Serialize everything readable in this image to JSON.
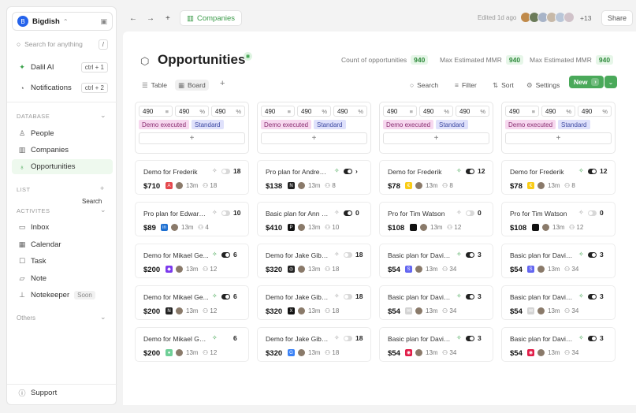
{
  "workspace": {
    "name": "Bigdish",
    "logo": "B"
  },
  "search": {
    "placeholder": "Search for anything",
    "shortcut": "/"
  },
  "top_nav": [
    {
      "label": "Dalil AI",
      "shortcut": "ctrl + 1",
      "icon": "sparkle-icon"
    },
    {
      "label": "Notifications",
      "shortcut": "ctrl + 2",
      "icon": "bell-icon"
    }
  ],
  "sections": {
    "database": "DATABASE",
    "list": "LIST",
    "list_search": "Search",
    "activities": "ACTIVITES",
    "others": "Others"
  },
  "database_items": [
    {
      "label": "People",
      "icon": "person-icon",
      "active": false
    },
    {
      "label": "Companies",
      "icon": "building-icon",
      "active": false
    },
    {
      "label": "Opportunities",
      "icon": "lightbulb-icon",
      "active": true
    }
  ],
  "activity_items": [
    {
      "label": "Inbox",
      "icon": "inbox-icon"
    },
    {
      "label": "Calendar",
      "icon": "calendar-icon"
    },
    {
      "label": "Task",
      "icon": "checkbox-icon"
    },
    {
      "label": "Note",
      "icon": "note-icon"
    },
    {
      "label": "Notekeeper",
      "icon": "pin-icon",
      "badge": "Soon"
    }
  ],
  "support": "Support",
  "header": {
    "breadcrumb": "Companies",
    "edited": "Edited 1d ago",
    "extra_avatars": "+13",
    "share": "Share"
  },
  "page": {
    "title": "Opportunities",
    "stats": [
      {
        "label": "Count of opportunities",
        "value": "940"
      },
      {
        "label": "Max Estimated MMR",
        "value": "940"
      },
      {
        "label": "Max Estimated MMR",
        "value": "940"
      }
    ]
  },
  "toolbar": {
    "views": [
      {
        "label": "Table",
        "active": false
      },
      {
        "label": "Board",
        "active": true
      }
    ],
    "search": "Search",
    "filter": "Filter",
    "sort": "Sort",
    "settings": "Settings",
    "new": "New"
  },
  "colors": {
    "accent": "#4aa95a",
    "tag_pink": "#f7d8ef",
    "tag_lavender": "#dfe1fb"
  },
  "columns": [
    {
      "filters": [
        {
          "value": "490",
          "op": "≡"
        },
        {
          "value": "490",
          "op": "%"
        },
        {
          "value": "490",
          "op": "%"
        }
      ],
      "tags": [
        "Demo executed",
        "Standard"
      ],
      "cards": [
        {
          "name": "Demo for Frederik",
          "spark": "grey",
          "toggle": "off",
          "count": "18",
          "amount": "$710",
          "logo_color": "#e5484d",
          "logo_glyph": "A",
          "time": "13m",
          "people": "18"
        },
        {
          "name": "Pro plan for Edwarw...",
          "spark": "grey",
          "toggle": "off",
          "count": "10",
          "amount": "$89",
          "logo_color": "#1d6fd1",
          "logo_glyph": "in",
          "time": "13m",
          "people": "4"
        },
        {
          "name": "Demo for Mikael Ge...",
          "spark": "green",
          "toggle": "on",
          "count": "6",
          "amount": "$200",
          "logo_color": "#7c3aed",
          "logo_glyph": "◆",
          "time": "13m",
          "people": "12"
        },
        {
          "name": "Demo for Mikael Ge...",
          "spark": "green",
          "toggle": "on",
          "count": "6",
          "amount": "$200",
          "logo_color": "#222222",
          "logo_glyph": "N",
          "time": "13m",
          "people": "12"
        },
        {
          "name": "Demo for Mikael George",
          "spark": "green",
          "toggle": "",
          "count": "6",
          "amount": "$200",
          "logo_color": "#6fcf97",
          "logo_glyph": "●",
          "time": "13m",
          "people": "12"
        }
      ]
    },
    {
      "filters": [
        {
          "value": "490",
          "op": "≡"
        },
        {
          "value": "490",
          "op": "%"
        },
        {
          "value": "490",
          "op": "%"
        }
      ],
      "tags": [
        "Demo executed",
        "Standard"
      ],
      "cards": [
        {
          "name": "Pro plan for Andrew ...",
          "spark": "green",
          "toggle": "on",
          "count": "›",
          "amount": "$138",
          "logo_color": "#222222",
          "logo_glyph": "N",
          "time": "13m",
          "people": "8"
        },
        {
          "name": "Basic plan for Ann Sas...",
          "spark": "grey",
          "toggle": "on",
          "count": "0",
          "amount": "$410",
          "logo_color": "#111111",
          "logo_glyph": "P",
          "time": "13m",
          "people": "10"
        },
        {
          "name": "Demo for Jake Gibson",
          "spark": "grey",
          "toggle": "off",
          "count": "18",
          "amount": "$320",
          "logo_color": "#222222",
          "logo_glyph": "◎",
          "time": "13m",
          "people": "18"
        },
        {
          "name": "Demo for Jake Gibson",
          "spark": "grey",
          "toggle": "off",
          "count": "18",
          "amount": "$320",
          "logo_color": "#111111",
          "logo_glyph": "X",
          "time": "13m",
          "people": "18"
        },
        {
          "name": "Demo for Jake Gibson",
          "spark": "grey",
          "toggle": "off",
          "count": "18",
          "amount": "$320",
          "logo_color": "#3b82f6",
          "logo_glyph": "G",
          "time": "13m",
          "people": "18"
        }
      ]
    },
    {
      "filters": [
        {
          "value": "490",
          "op": "≡"
        },
        {
          "value": "490",
          "op": "%"
        },
        {
          "value": "490",
          "op": "%"
        }
      ],
      "tags": [
        "Demo executed",
        "Standard"
      ],
      "cards": [
        {
          "name": "Demo for Frederik",
          "spark": "green",
          "toggle": "on",
          "count": "12",
          "amount": "$78",
          "logo_color": "#facc15",
          "logo_glyph": "€",
          "time": "13m",
          "people": "8"
        },
        {
          "name": "Pro for Tim Watson",
          "spark": "grey",
          "toggle": "off",
          "count": "0",
          "amount": "$108",
          "logo_color": "#111111",
          "logo_glyph": "",
          "time": "13m",
          "people": "12"
        },
        {
          "name": "Basic plan for David w...",
          "spark": "green",
          "toggle": "on",
          "count": "3",
          "amount": "$54",
          "logo_color": "#6366f1",
          "logo_glyph": "S",
          "time": "13m",
          "people": "34"
        },
        {
          "name": "Basic plan for David w...",
          "spark": "green",
          "toggle": "on",
          "count": "3",
          "amount": "$54",
          "logo_color": "#d4d4d4",
          "logo_glyph": "✉",
          "time": "13m",
          "people": "34"
        },
        {
          "name": "Basic plan for David w...",
          "spark": "green",
          "toggle": "on",
          "count": "3",
          "amount": "$54",
          "logo_color": "#e11d48",
          "logo_glyph": "◉",
          "time": "13m",
          "people": "34"
        }
      ]
    },
    {
      "filters": [
        {
          "value": "490",
          "op": "≡"
        },
        {
          "value": "490",
          "op": "%"
        },
        {
          "value": "490",
          "op": "%"
        }
      ],
      "tags": [
        "Demo executed",
        "Standard"
      ],
      "cards": [
        {
          "name": "Demo for Frederik",
          "spark": "green",
          "toggle": "on",
          "count": "12",
          "amount": "$78",
          "logo_color": "#facc15",
          "logo_glyph": "€",
          "time": "13m",
          "people": "8"
        },
        {
          "name": "Pro for Tim Watson",
          "spark": "grey",
          "toggle": "off",
          "count": "0",
          "amount": "$108",
          "logo_color": "#111111",
          "logo_glyph": "",
          "time": "13m",
          "people": "12"
        },
        {
          "name": "Basic plan for David w...",
          "spark": "green",
          "toggle": "on",
          "count": "3",
          "amount": "$54",
          "logo_color": "#6366f1",
          "logo_glyph": "S",
          "time": "13m",
          "people": "34"
        },
        {
          "name": "Basic plan for David w...",
          "spark": "green",
          "toggle": "on",
          "count": "3",
          "amount": "$54",
          "logo_color": "#d4d4d4",
          "logo_glyph": "✉",
          "time": "13m",
          "people": "34"
        },
        {
          "name": "Basic plan for David w...",
          "spark": "green",
          "toggle": "on",
          "count": "3",
          "amount": "$54",
          "logo_color": "#e11d48",
          "logo_glyph": "◉",
          "time": "13m",
          "people": "34"
        }
      ]
    }
  ]
}
